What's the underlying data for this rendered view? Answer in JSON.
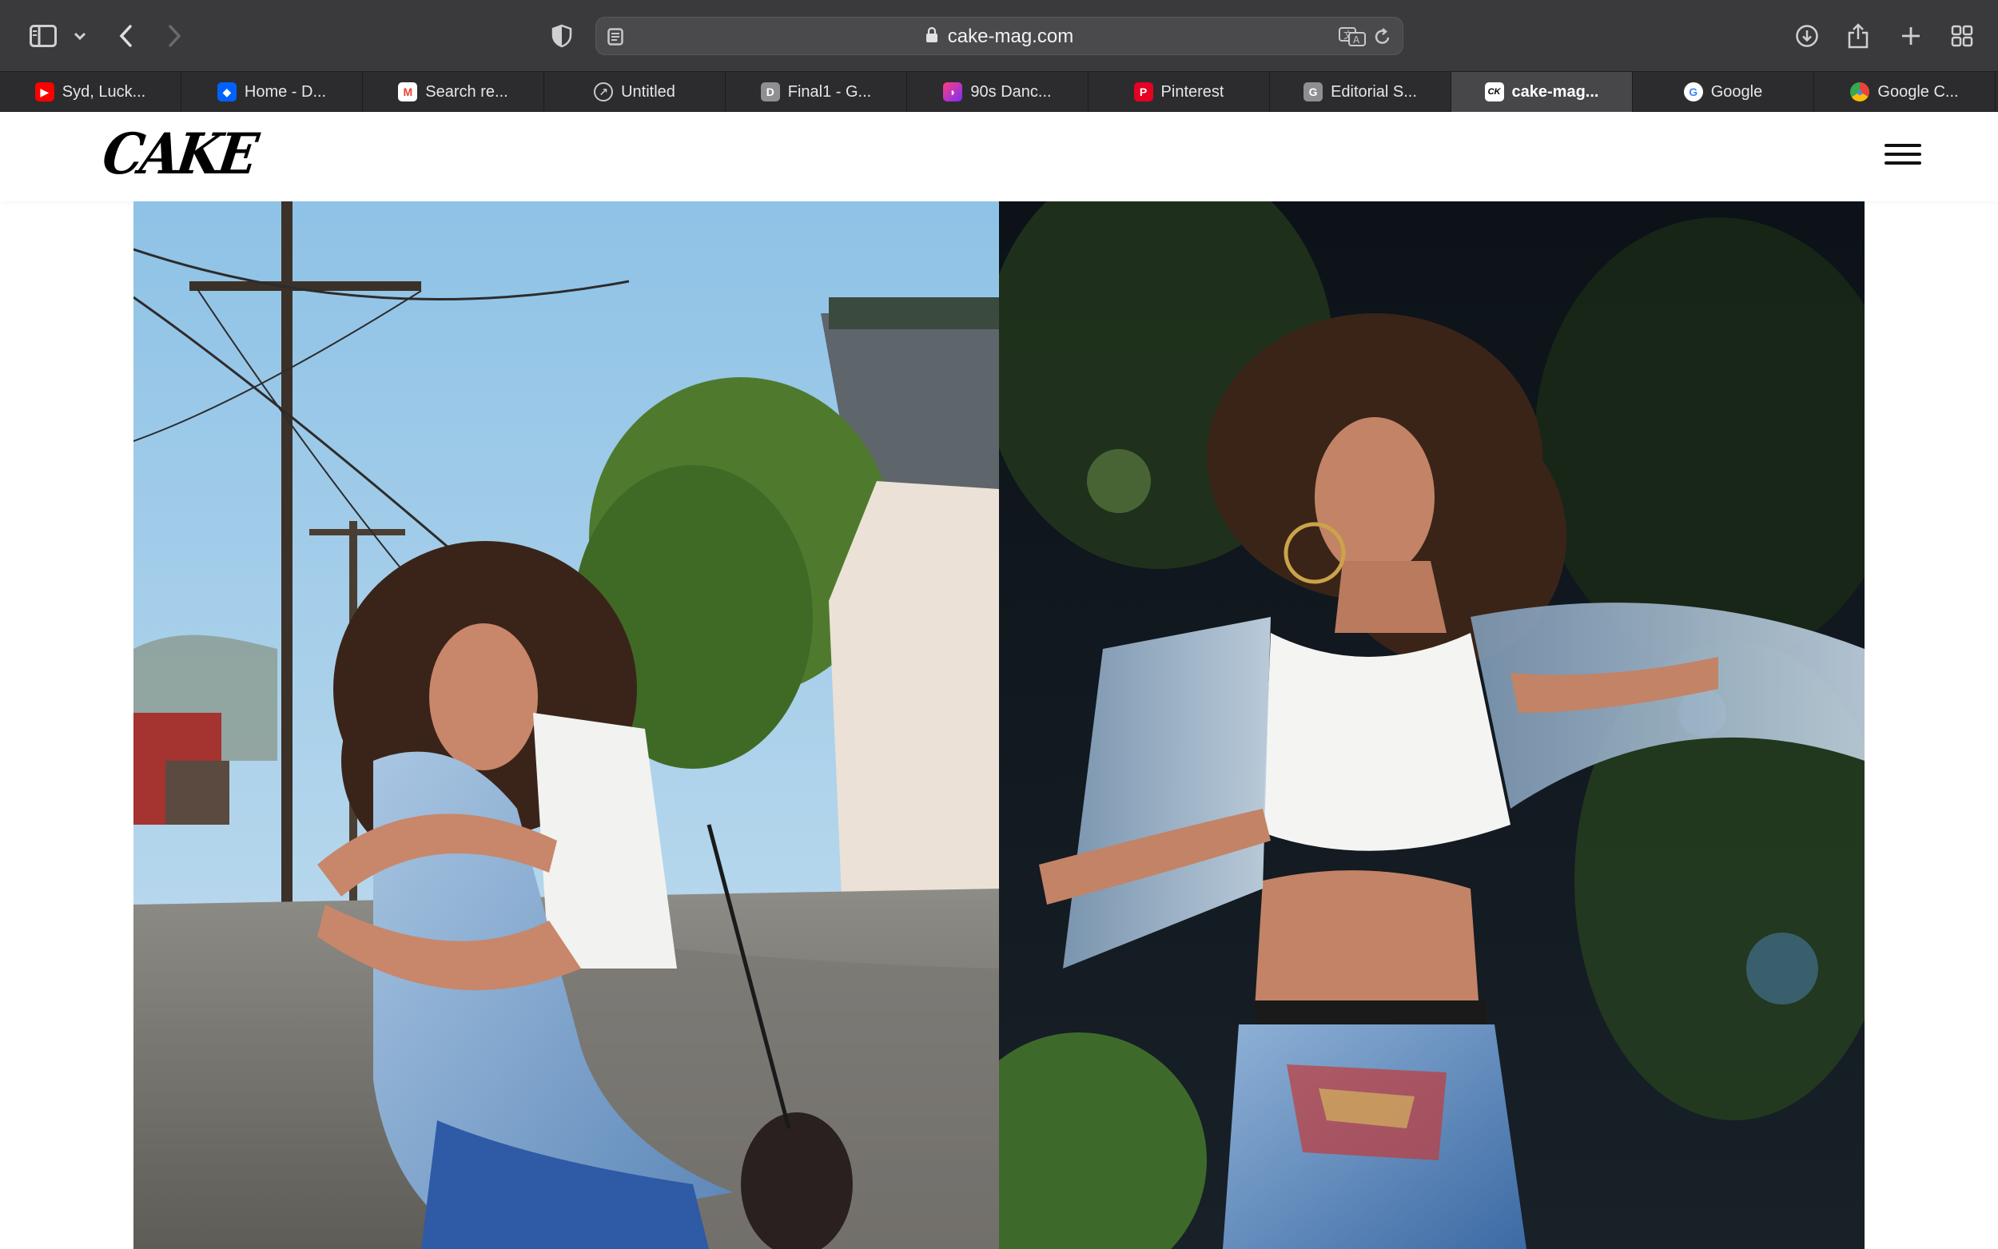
{
  "browser": {
    "url": "cake-mag.com",
    "icons": {
      "sidebar": "sidebar-icon",
      "sidebar_menu": "chevron-down-icon",
      "back": "back-arrow-icon",
      "forward": "forward-arrow-icon",
      "privacy": "shield-icon",
      "reader": "reader-icon",
      "lock": "lock-icon",
      "translate": "translate-icon",
      "reload": "reload-icon",
      "downloads": "download-icon",
      "share": "share-icon",
      "new_tab": "plus-icon",
      "tab_overview": "grid-icon"
    }
  },
  "tabs": [
    {
      "label": "Syd, Luck...",
      "favicon": "youtube-icon",
      "color": "#ff0000",
      "glyph": "▶",
      "active": false
    },
    {
      "label": "Home - D...",
      "favicon": "dropbox-icon",
      "color": "#0061fe",
      "glyph": "◆",
      "active": false
    },
    {
      "label": "Search re...",
      "favicon": "gmail-icon",
      "color": "#ea4335",
      "glyph": "M",
      "active": false
    },
    {
      "label": "Untitled",
      "favicon": "compass-icon",
      "color": "#8e8e93",
      "glyph": "◎",
      "active": false
    },
    {
      "label": "Final1 - G...",
      "favicon": "docs-icon",
      "color": "#8e8e93",
      "glyph": "D",
      "active": false
    },
    {
      "label": "90s Danc...",
      "favicon": "figma-icon",
      "color": "#a259ff",
      "glyph": "◗",
      "active": false
    },
    {
      "label": "Pinterest",
      "favicon": "pinterest-icon",
      "color": "#e60023",
      "glyph": "P",
      "active": false
    },
    {
      "label": "Editorial S...",
      "favicon": "google-doc-icon",
      "color": "#8e8e93",
      "glyph": "G",
      "active": false
    },
    {
      "label": "cake-mag...",
      "favicon": "cake-icon",
      "color": "#ffffff",
      "glyph": "C",
      "active": true
    },
    {
      "label": "Google",
      "favicon": "google-icon",
      "color": "#ffffff",
      "glyph": "G",
      "active": false
    },
    {
      "label": "Google C...",
      "favicon": "chrome-icon",
      "color": "#ffffff",
      "glyph": "◉",
      "active": false
    }
  ],
  "site": {
    "logo_text": "CAKE",
    "menu_icon": "hamburger-menu-icon"
  },
  "colors": {
    "toolbar_bg": "#3a3a3c",
    "tabstrip_bg": "#2c2c2e",
    "active_tab_bg": "#47474a",
    "page_bg": "#ffffff"
  }
}
